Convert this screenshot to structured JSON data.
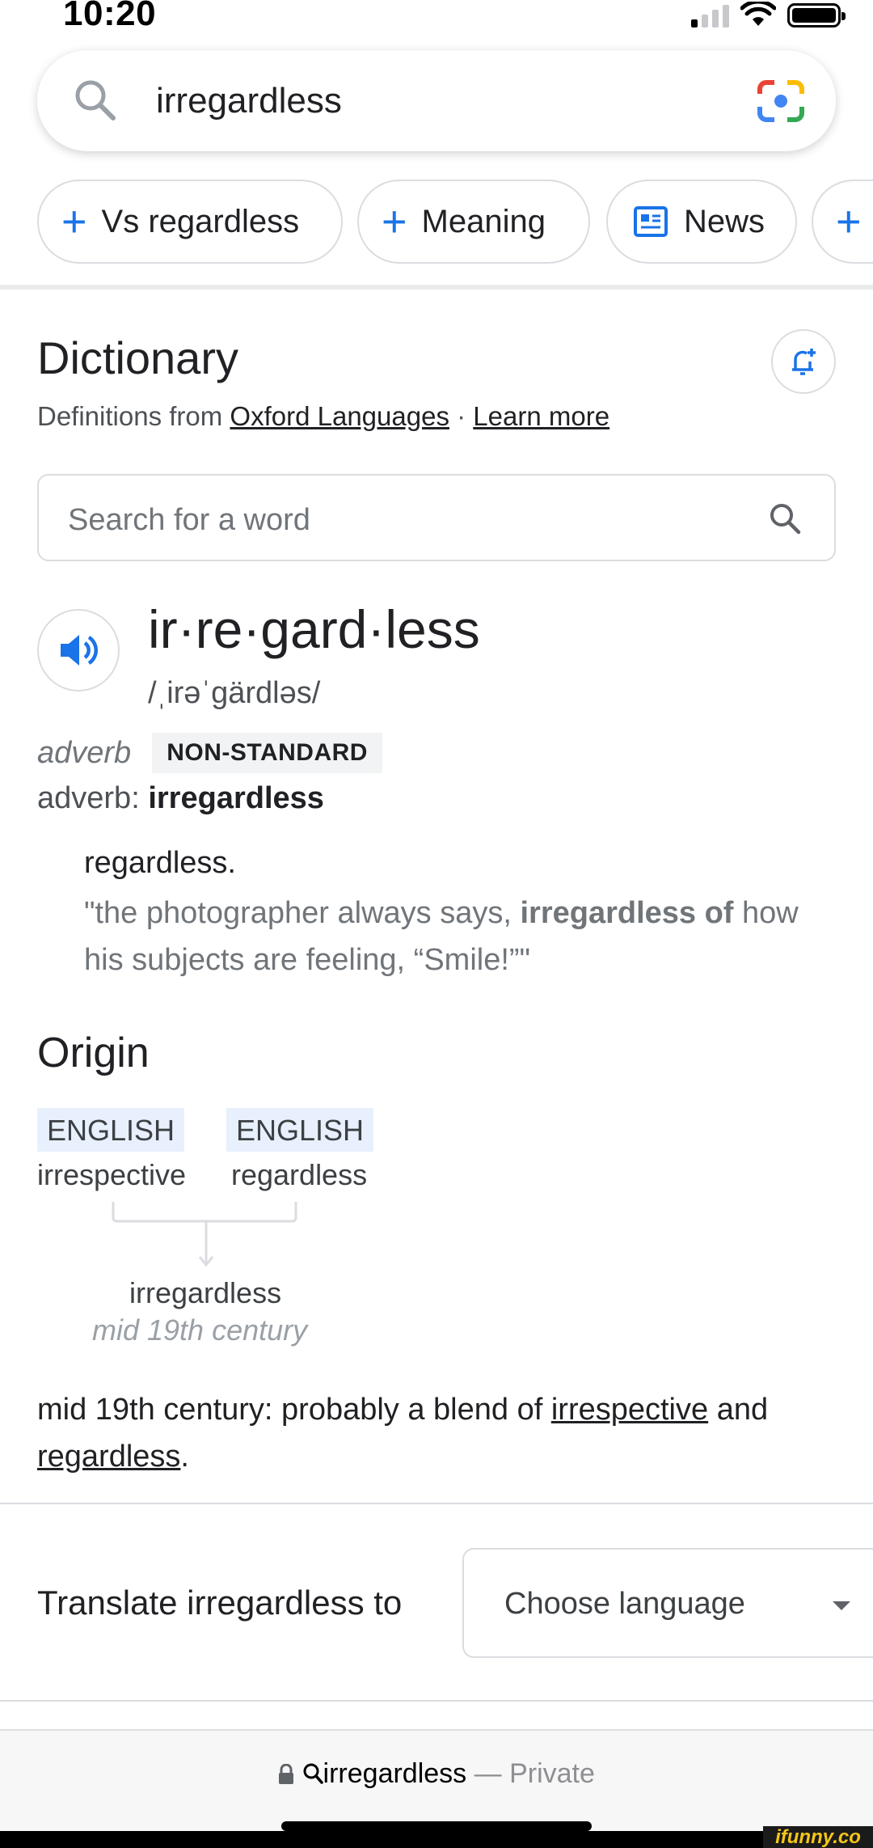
{
  "status": {
    "time": "10:20"
  },
  "search": {
    "query": "irregardless"
  },
  "chips": [
    {
      "label": "Vs regardless",
      "icon": "plus-icon"
    },
    {
      "label": "Meaning",
      "icon": "plus-icon"
    },
    {
      "label": "News",
      "icon": "news-icon"
    },
    {
      "label": "",
      "icon": "plus-icon"
    }
  ],
  "dictionary": {
    "title": "Dictionary",
    "sub_prefix": "Definitions from",
    "source_link": "Oxford Languages",
    "separator": "·",
    "learn_more": "Learn more",
    "search_placeholder": "Search for a word"
  },
  "entry": {
    "headword": "ir·re·gard·less",
    "phonetic": "/ˌirəˈɡärdləs/",
    "pos": "adverb",
    "badge": "NON-STANDARD",
    "adverb_label": "adverb",
    "adverb_colon": ":",
    "adverb_word": "irregardless",
    "definition": "regardless.",
    "example_pre": "\"the photographer always says, ",
    "example_bold": "irregardless of",
    "example_post": " how his subjects are feeling, “Smile!”\""
  },
  "origin": {
    "title": "Origin",
    "sources": [
      {
        "lang": "ENGLISH",
        "word": "irrespective"
      },
      {
        "lang": "ENGLISH",
        "word": "regardless"
      }
    ],
    "result_word": "irregardless",
    "result_date": "mid 19th century",
    "text_pre": "mid 19th century: probably a blend of ",
    "link1": "irrespective",
    "text_mid": " and",
    "link2": "regardless",
    "text_end": "."
  },
  "translate": {
    "label": "Translate irregardless to",
    "select_value": "Choose language"
  },
  "address_bar": {
    "query": "irregardless",
    "separator": "—",
    "mode": "Private"
  },
  "watermark": "ifunny.co",
  "colors": {
    "accent": "#1a73e8",
    "tag_bg": "#e8f0fe"
  }
}
